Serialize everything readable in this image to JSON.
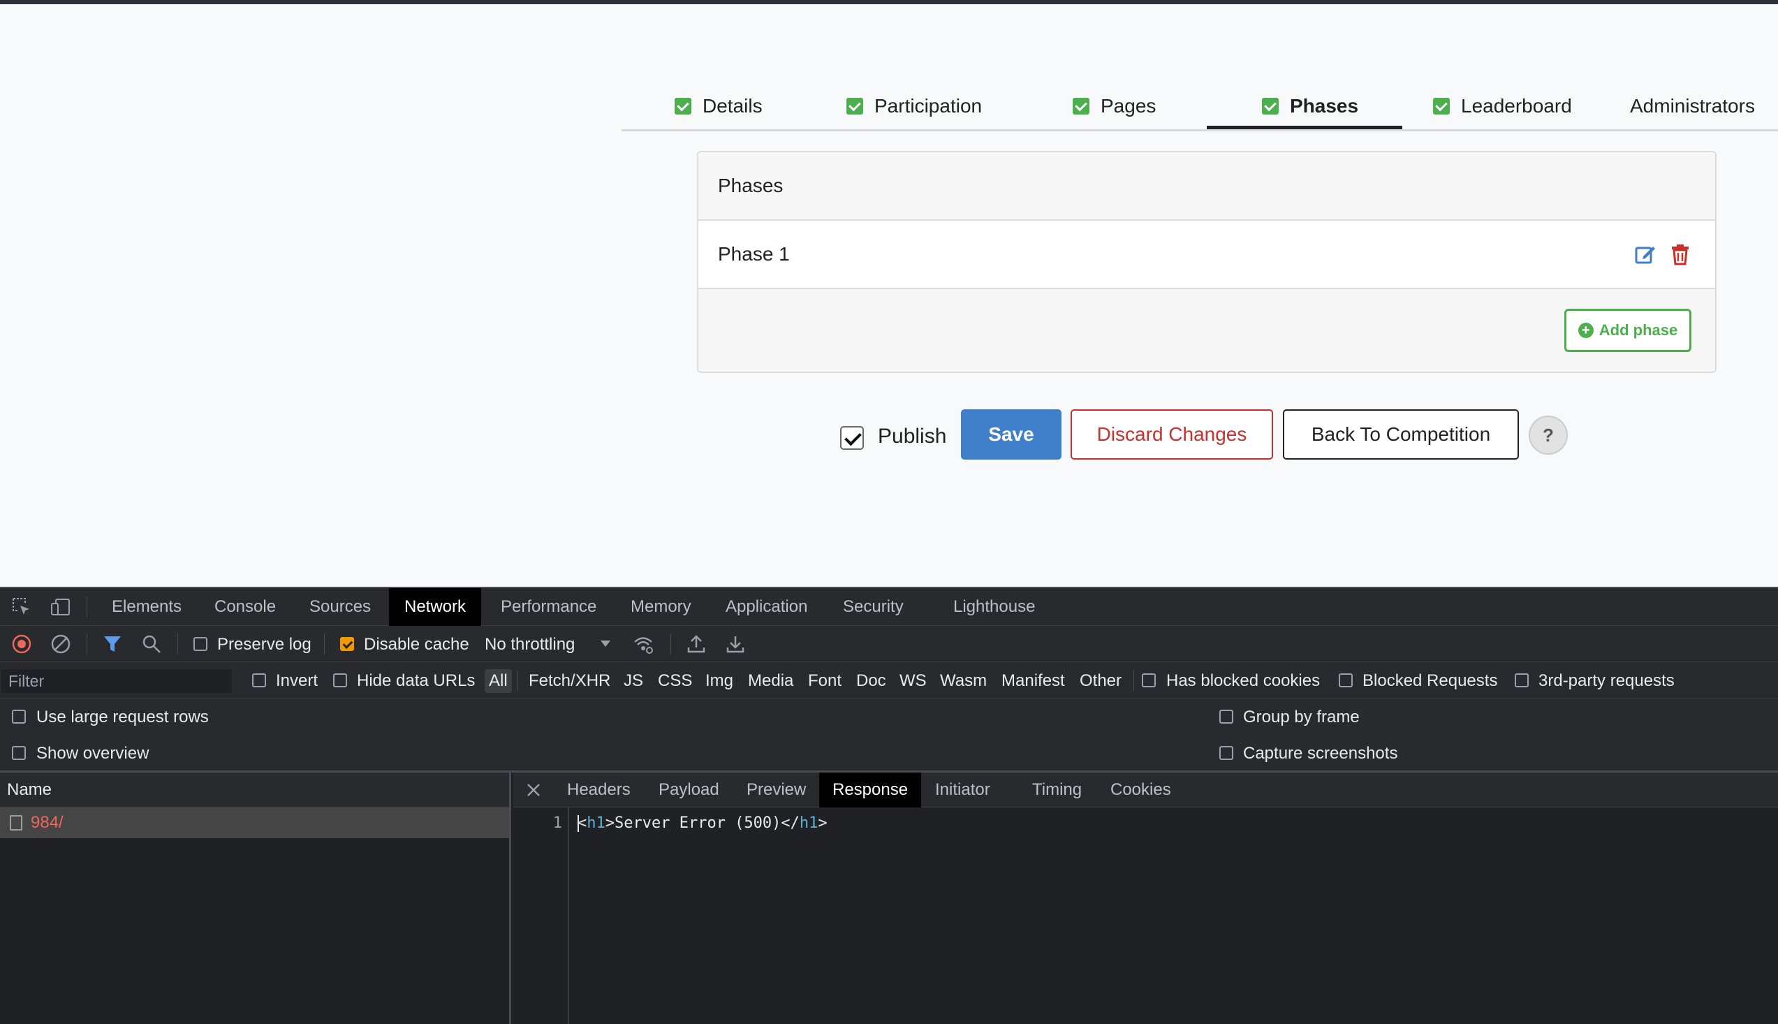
{
  "tabs": [
    {
      "label": "Details",
      "checked": true
    },
    {
      "label": "Participation",
      "checked": true
    },
    {
      "label": "Pages",
      "checked": true
    },
    {
      "label": "Phases",
      "checked": true,
      "active": true
    },
    {
      "label": "Leaderboard",
      "checked": true
    },
    {
      "label": "Administrators",
      "checked": false
    }
  ],
  "phases_panel": {
    "title": "Phases",
    "rows": [
      {
        "name": "Phase 1",
        "edit_icon": "edit-icon",
        "delete_icon": "trash-icon"
      }
    ],
    "add_label": "Add phase",
    "add_icon": "plus-circle-icon"
  },
  "actions": {
    "publish_label": "Publish",
    "publish_checked": true,
    "save_label": "Save",
    "discard_label": "Discard Changes",
    "back_label": "Back To Competition",
    "help_label": "?"
  },
  "devtools": {
    "tabs": [
      "Elements",
      "Console",
      "Sources",
      "Network",
      "Performance",
      "Memory",
      "Application",
      "Security",
      "Lighthouse"
    ],
    "active_tab": "Network",
    "toolbar": {
      "preserve_log": "Preserve log",
      "preserve_log_checked": false,
      "disable_cache": "Disable cache",
      "disable_cache_checked": true,
      "throttling": "No throttling"
    },
    "filter": {
      "placeholder": "Filter",
      "invert": "Invert",
      "hide_data_urls": "Hide data URLs",
      "types": [
        "All",
        "Fetch/XHR",
        "JS",
        "CSS",
        "Img",
        "Media",
        "Font",
        "Doc",
        "WS",
        "Wasm",
        "Manifest",
        "Other"
      ],
      "active_type": "All",
      "has_blocked_cookies": "Has blocked cookies",
      "blocked_requests": "Blocked Requests",
      "third_party": "3rd-party requests"
    },
    "options": {
      "large_rows": "Use large request rows",
      "show_overview": "Show overview",
      "group_by_frame": "Group by frame",
      "capture_screenshots": "Capture screenshots"
    },
    "requests": {
      "header": "Name",
      "items": [
        {
          "name": "984/",
          "status": "error"
        }
      ]
    },
    "detail": {
      "tabs": [
        "Headers",
        "Payload",
        "Preview",
        "Response",
        "Initiator",
        "Timing",
        "Cookies"
      ],
      "active_tab": "Response",
      "line_number": "1",
      "response": {
        "open_lt": "<",
        "open_tag": "h1",
        "open_gt": ">",
        "text": "Server Error (500)",
        "close_lt": "</",
        "close_tag": "h1",
        "close_gt": ">"
      }
    }
  },
  "colors": {
    "accent_green": "#4cae4c",
    "primary_blue": "#3f7fc9",
    "danger_red": "#c9302c",
    "devtools_bg": "#202124",
    "error_text": "#ee675c"
  }
}
